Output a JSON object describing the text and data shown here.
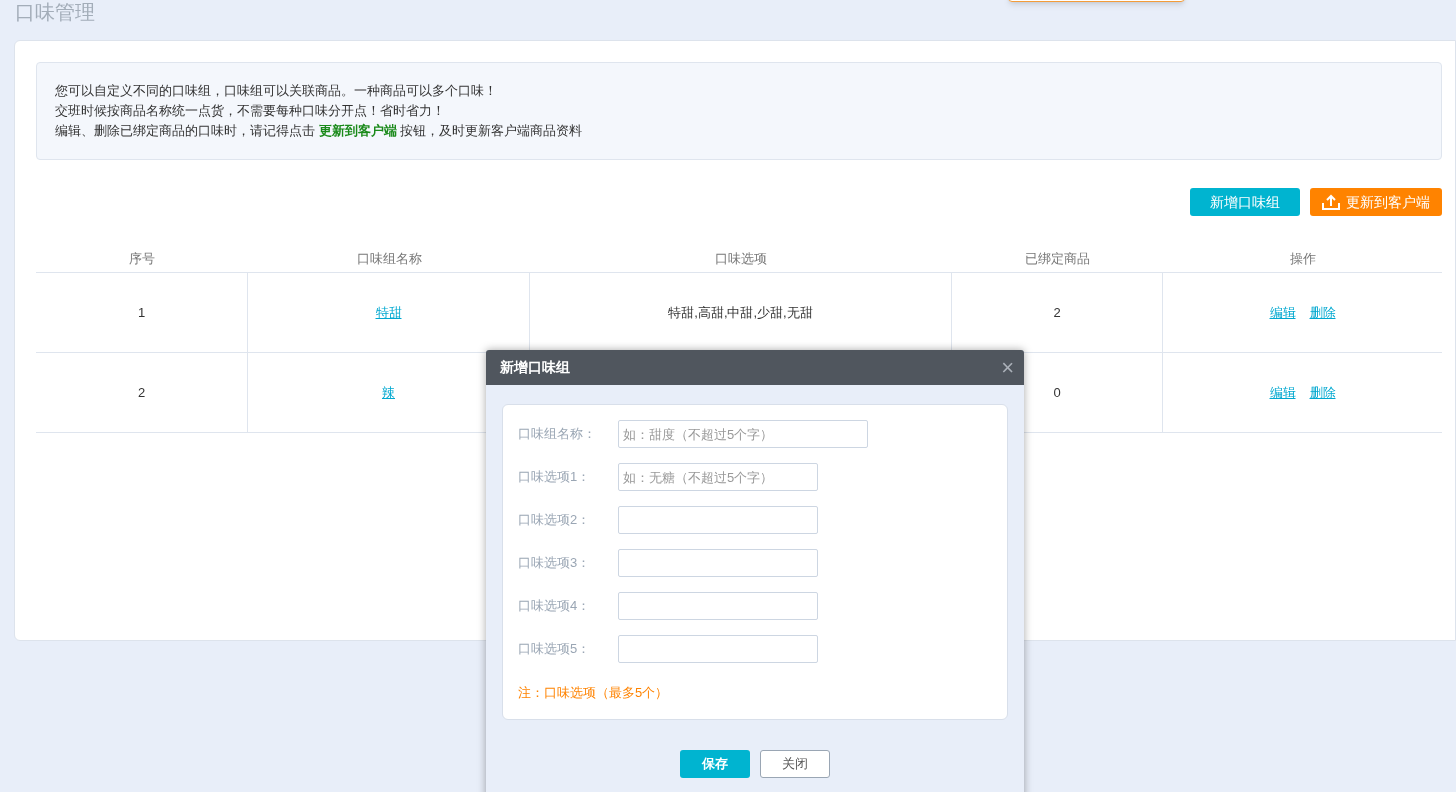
{
  "page_title": "口味管理",
  "notice": [
    "您可以自定义不同的口味组，口味组可以关联商品。一种商品可以多个口味！",
    "交班时候按商品名称统一点货，不需要每种口味分开点！省时省力！",
    "编辑、删除已绑定商品的口味时，请记得点击 **更新到客户端** 按钮，及时更新客户端商品资料"
  ],
  "toolbar": [
    {
      "kind": "add",
      "label": "新增口味组"
    },
    {
      "kind": "sync",
      "label": "更新到客户端"
    }
  ],
  "table": {
    "columns": [
      "序号",
      "口味组名称",
      "口味选项",
      "已绑定商品",
      "操作"
    ],
    "rows": [
      {
        "index": "1",
        "name": "特甜",
        "options": "特甜,高甜,中甜,少甜,无甜",
        "bound": "2",
        "actions": [
          "编辑",
          "删除"
        ]
      },
      {
        "index": "2",
        "name": "辣",
        "bound": "0",
        "actions": [
          "编辑",
          "删除"
        ]
      }
    ]
  },
  "dialog": {
    "title": "新增口味组",
    "close": "×",
    "fields": [
      {
        "label": "口味组名称：",
        "placeholder": "如：甜度（不超过5个字）",
        "kind": "wide"
      },
      {
        "label": "口味选项1：",
        "placeholder": "如：无糖（不超过5个字）",
        "kind": "normal"
      },
      {
        "label": "口味选项2：",
        "kind": "normal"
      },
      {
        "label": "口味选项3：",
        "kind": "normal"
      },
      {
        "label": "口味选项4：",
        "kind": "normal"
      },
      {
        "label": "口味选项5：",
        "kind": "normal"
      }
    ],
    "note": "注：口味选项（最多5个）",
    "buttons": [
      {
        "kind": "primary",
        "label": "保存"
      },
      {
        "kind": "secondary",
        "label": "关闭"
      }
    ]
  }
}
